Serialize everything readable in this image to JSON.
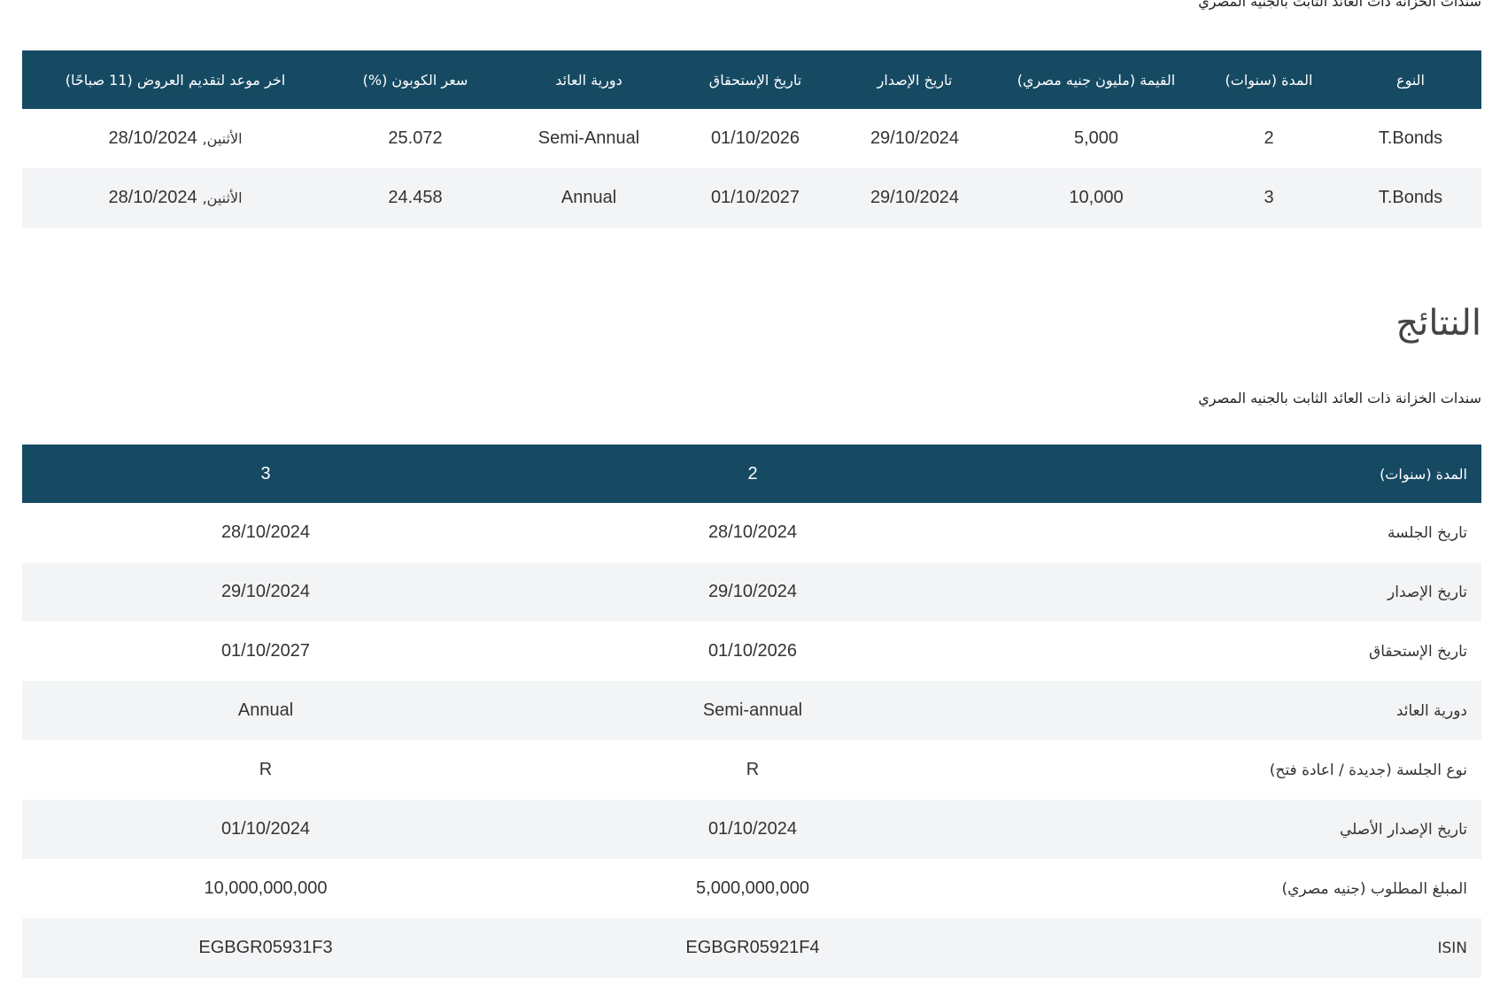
{
  "offers": {
    "caption": "سندات الخزانة ذات العائد الثابت بالجنيه المصري",
    "headers": {
      "type": "النوع",
      "tenor": "المدة (سنوات)",
      "amount": "القيمة (مليون جنيه مصري)",
      "issue_date": "تاريخ الإصدار",
      "maturity_date": "تاريخ الإستحقاق",
      "frequency": "دورية العائد",
      "coupon": "سعر الكوبون (%)",
      "deadline": "اخر موعد لتقديم العروض (11 صباحًا)"
    },
    "rows": [
      {
        "type": "T.Bonds",
        "tenor": "2",
        "amount": "5,000",
        "issue_date": "29/10/2024",
        "maturity_date": "01/10/2026",
        "frequency": "Semi-Annual",
        "coupon": "25.072",
        "deadline_date": "28/10/2024",
        "deadline_day": "الأثنين,"
      },
      {
        "type": "T.Bonds",
        "tenor": "3",
        "amount": "10,000",
        "issue_date": "29/10/2024",
        "maturity_date": "01/10/2027",
        "frequency": "Annual",
        "coupon": "24.458",
        "deadline_date": "28/10/2024",
        "deadline_day": "الأثنين,"
      }
    ]
  },
  "results": {
    "title": "النتائج",
    "caption": "سندات الخزانة ذات العائد الثابت بالجنيه المصري",
    "header": {
      "label": "المدة (سنوات)",
      "col1": "2",
      "col2": "3"
    },
    "rows": [
      {
        "label": "تاريخ الجلسة",
        "col1": "28/10/2024",
        "col2": "28/10/2024"
      },
      {
        "label": "تاريخ الإصدار",
        "col1": "29/10/2024",
        "col2": "29/10/2024"
      },
      {
        "label": "تاريخ الإستحقاق",
        "col1": "01/10/2026",
        "col2": "01/10/2027"
      },
      {
        "label": "دورية العائد",
        "col1": "Semi-annual",
        "col2": "Annual"
      },
      {
        "label": "نوع الجلسة (جديدة / اعادة فتح)",
        "col1": "R",
        "col2": "R"
      },
      {
        "label": "تاريخ الإصدار الأصلي",
        "col1": "01/10/2024",
        "col2": "01/10/2024"
      },
      {
        "label": "المبلغ المطلوب (جنيه مصري)",
        "col1": "5,000,000,000",
        "col2": "10,000,000,000"
      },
      {
        "label": "ISIN",
        "col1": "EGBGR05921F4",
        "col2": "EGBGR05931F3"
      }
    ]
  }
}
